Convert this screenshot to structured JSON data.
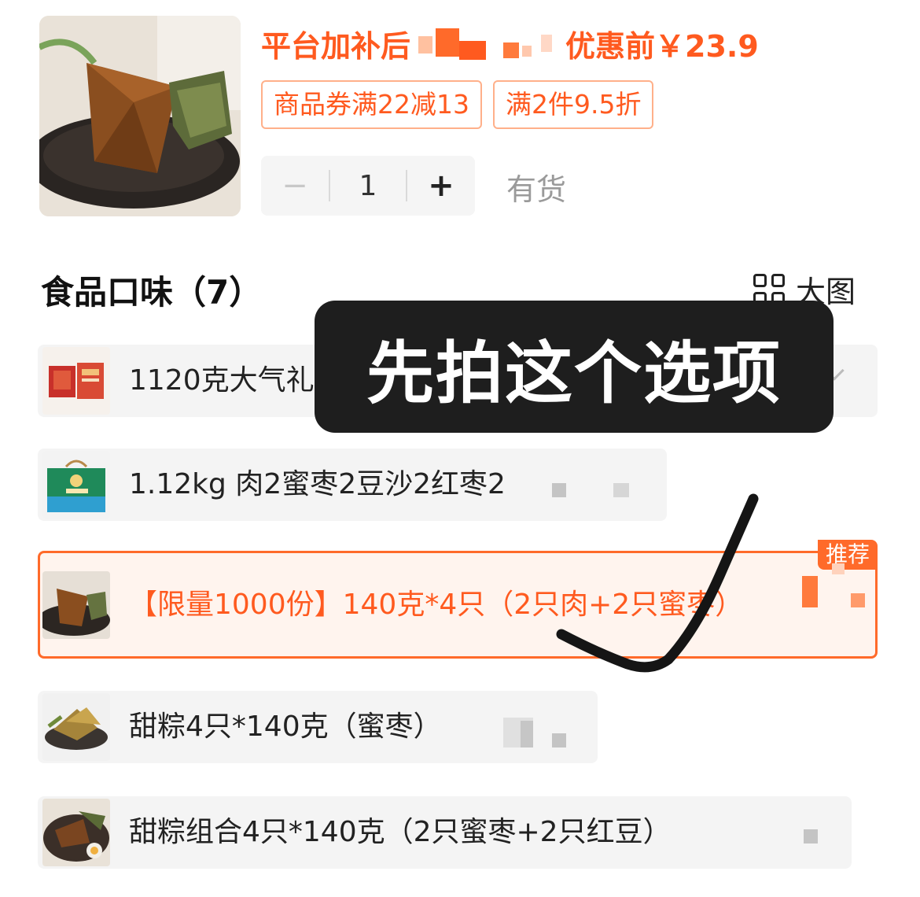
{
  "product": {
    "price_prefix": "平台加补后",
    "price_suffix": "优惠前￥23.9",
    "coupons": [
      "商品券满22减13",
      "满2件9.5折"
    ],
    "quantity": "1",
    "minus": "−",
    "plus": "+",
    "stock": "有货"
  },
  "flavors": {
    "title": "食品口味（7）",
    "view_toggle": "大图",
    "options": [
      {
        "label": "1120克大气礼盒装（肉2+豆沙+肉+红枣）×2"
      },
      {
        "label": "1.12kg 肉2蜜枣2豆沙2红枣2"
      },
      {
        "label": "【限量1000份】140克*4只（2只肉+2只蜜枣）",
        "badge": "推荐",
        "selected": true
      },
      {
        "label": "甜粽4只*140克（蜜枣）"
      },
      {
        "label": "甜粽组合4只*140克（2只蜜枣+2只红豆）"
      }
    ]
  },
  "annotation": {
    "callout": "先拍这个选项"
  },
  "colors": {
    "accent": "#ff5a1f",
    "selected_bg": "#fff4ee",
    "option_bg": "#f4f4f4"
  }
}
